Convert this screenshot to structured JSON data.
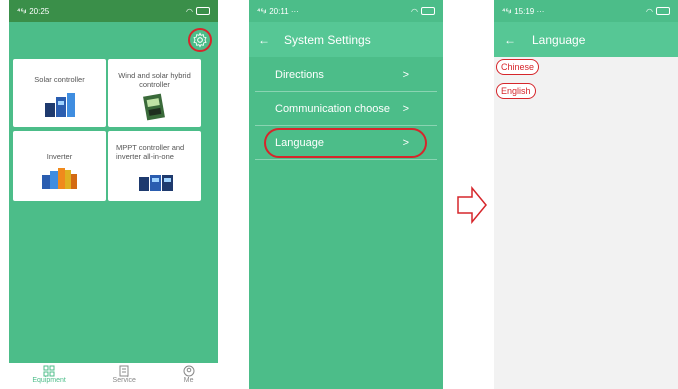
{
  "screen1": {
    "status_time": "20:25",
    "cards": [
      {
        "label": "Solar controller"
      },
      {
        "label": "Wind and solar hybrid controller"
      },
      {
        "label": "Inverter"
      },
      {
        "label": "MPPT controller and inverter all-in-one"
      }
    ],
    "nav": [
      {
        "label": "Equipment",
        "icon": "grid-icon"
      },
      {
        "label": "Service",
        "icon": "document-icon"
      },
      {
        "label": "Me",
        "icon": "user-icon"
      }
    ]
  },
  "screen2": {
    "status_time": "20:11 ···",
    "title": "System Settings",
    "back": "←",
    "items": [
      {
        "label": "Directions",
        "chevron": ">"
      },
      {
        "label": "Communication choose",
        "chevron": ">"
      },
      {
        "label": "Language",
        "chevron": ">"
      }
    ]
  },
  "screen3": {
    "status_time": "15:19 ···",
    "title": "Language",
    "back": "←",
    "options": [
      {
        "label": "Chinese"
      },
      {
        "label": "English"
      }
    ]
  },
  "colors": {
    "accent": "#4cbd89",
    "status_dark": "#3a8f49",
    "highlight": "#d6262b"
  }
}
